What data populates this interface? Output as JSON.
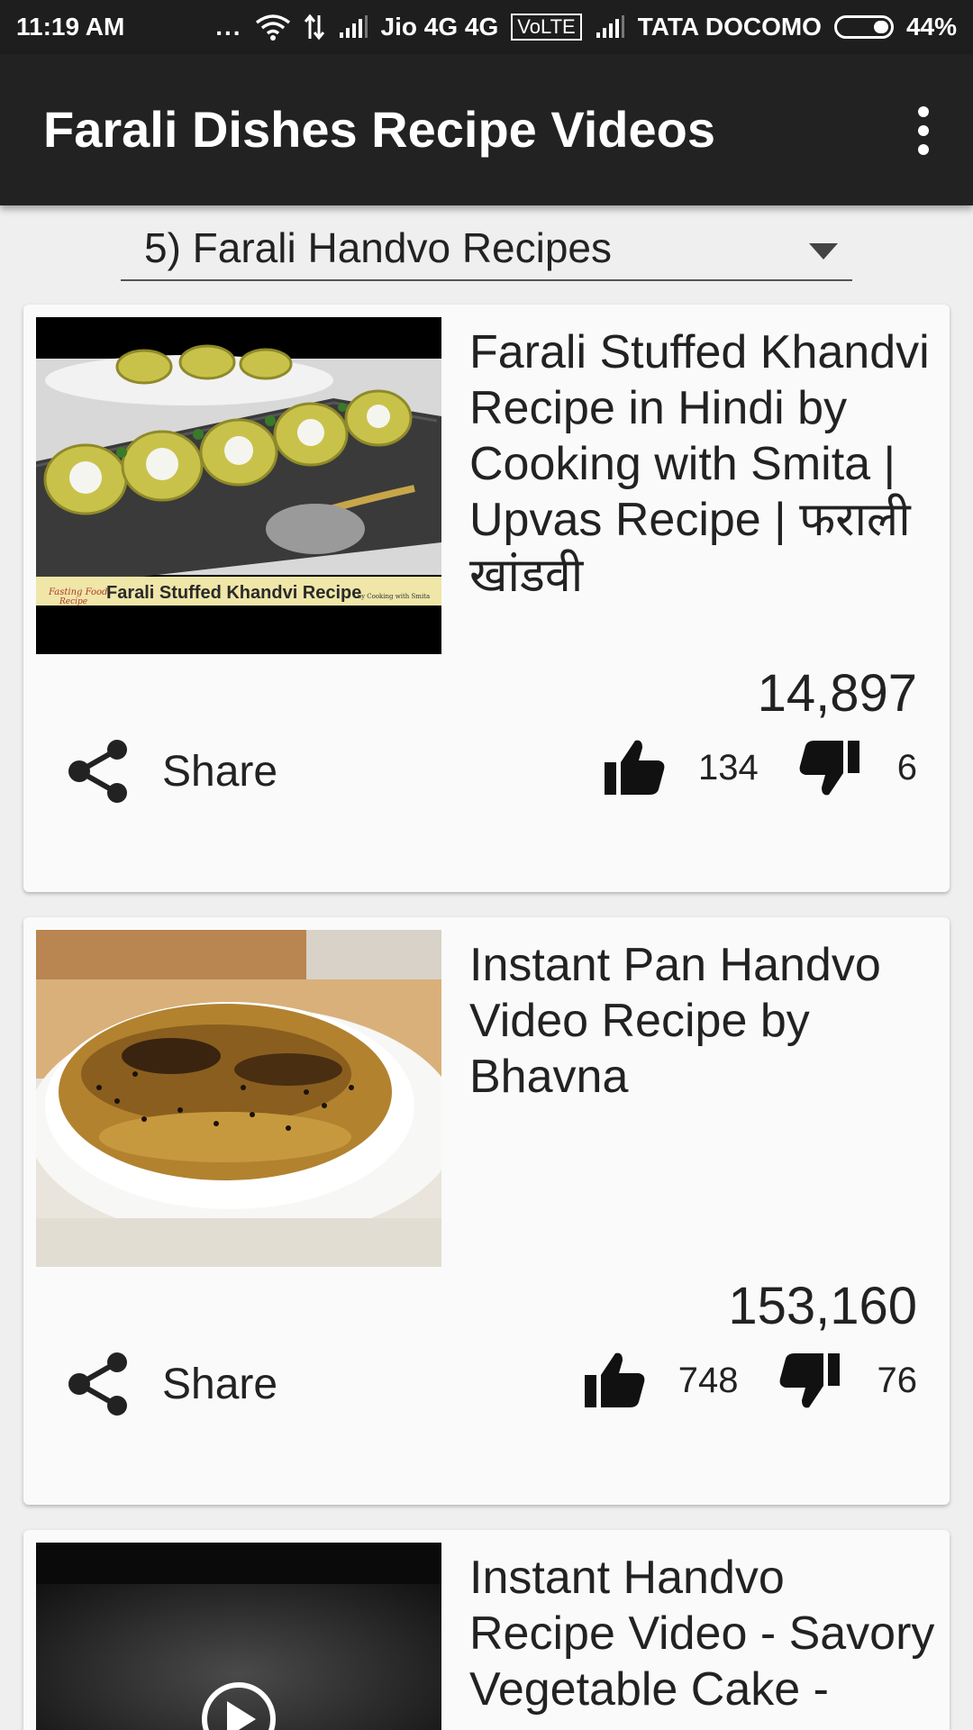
{
  "status_bar": {
    "time": "11:19 AM",
    "dots": "...",
    "carrier1": "Jio 4G 4G",
    "volte": "VoLTE",
    "carrier2": "TATA DOCOMO",
    "battery": "44%"
  },
  "app_bar": {
    "title": "Farali Dishes Recipe Videos"
  },
  "spinner": {
    "selected": "5) Farali Handvo Recipes"
  },
  "videos": [
    {
      "title": "Farali Stuffed Khandvi Recipe in Hindi by Cooking with Smita | Upvas Recipe | फराली खांडवी",
      "thumb_caption": "Farali Stuffed Khandvi Recipe",
      "thumb_badge_line1": "Fasting Food",
      "thumb_badge_line2": "Recipe",
      "thumb_credit": "- by Cooking with Smita",
      "views": "14,897",
      "share_label": "Share",
      "likes": "134",
      "dislikes": "6"
    },
    {
      "title": "Instant Pan Handvo Video Recipe by Bhavna",
      "views": "153,160",
      "share_label": "Share",
      "likes": "748",
      "dislikes": "76"
    },
    {
      "title": "Instant  Handvo Recipe Video - Savory Vegetable Cake -"
    }
  ]
}
